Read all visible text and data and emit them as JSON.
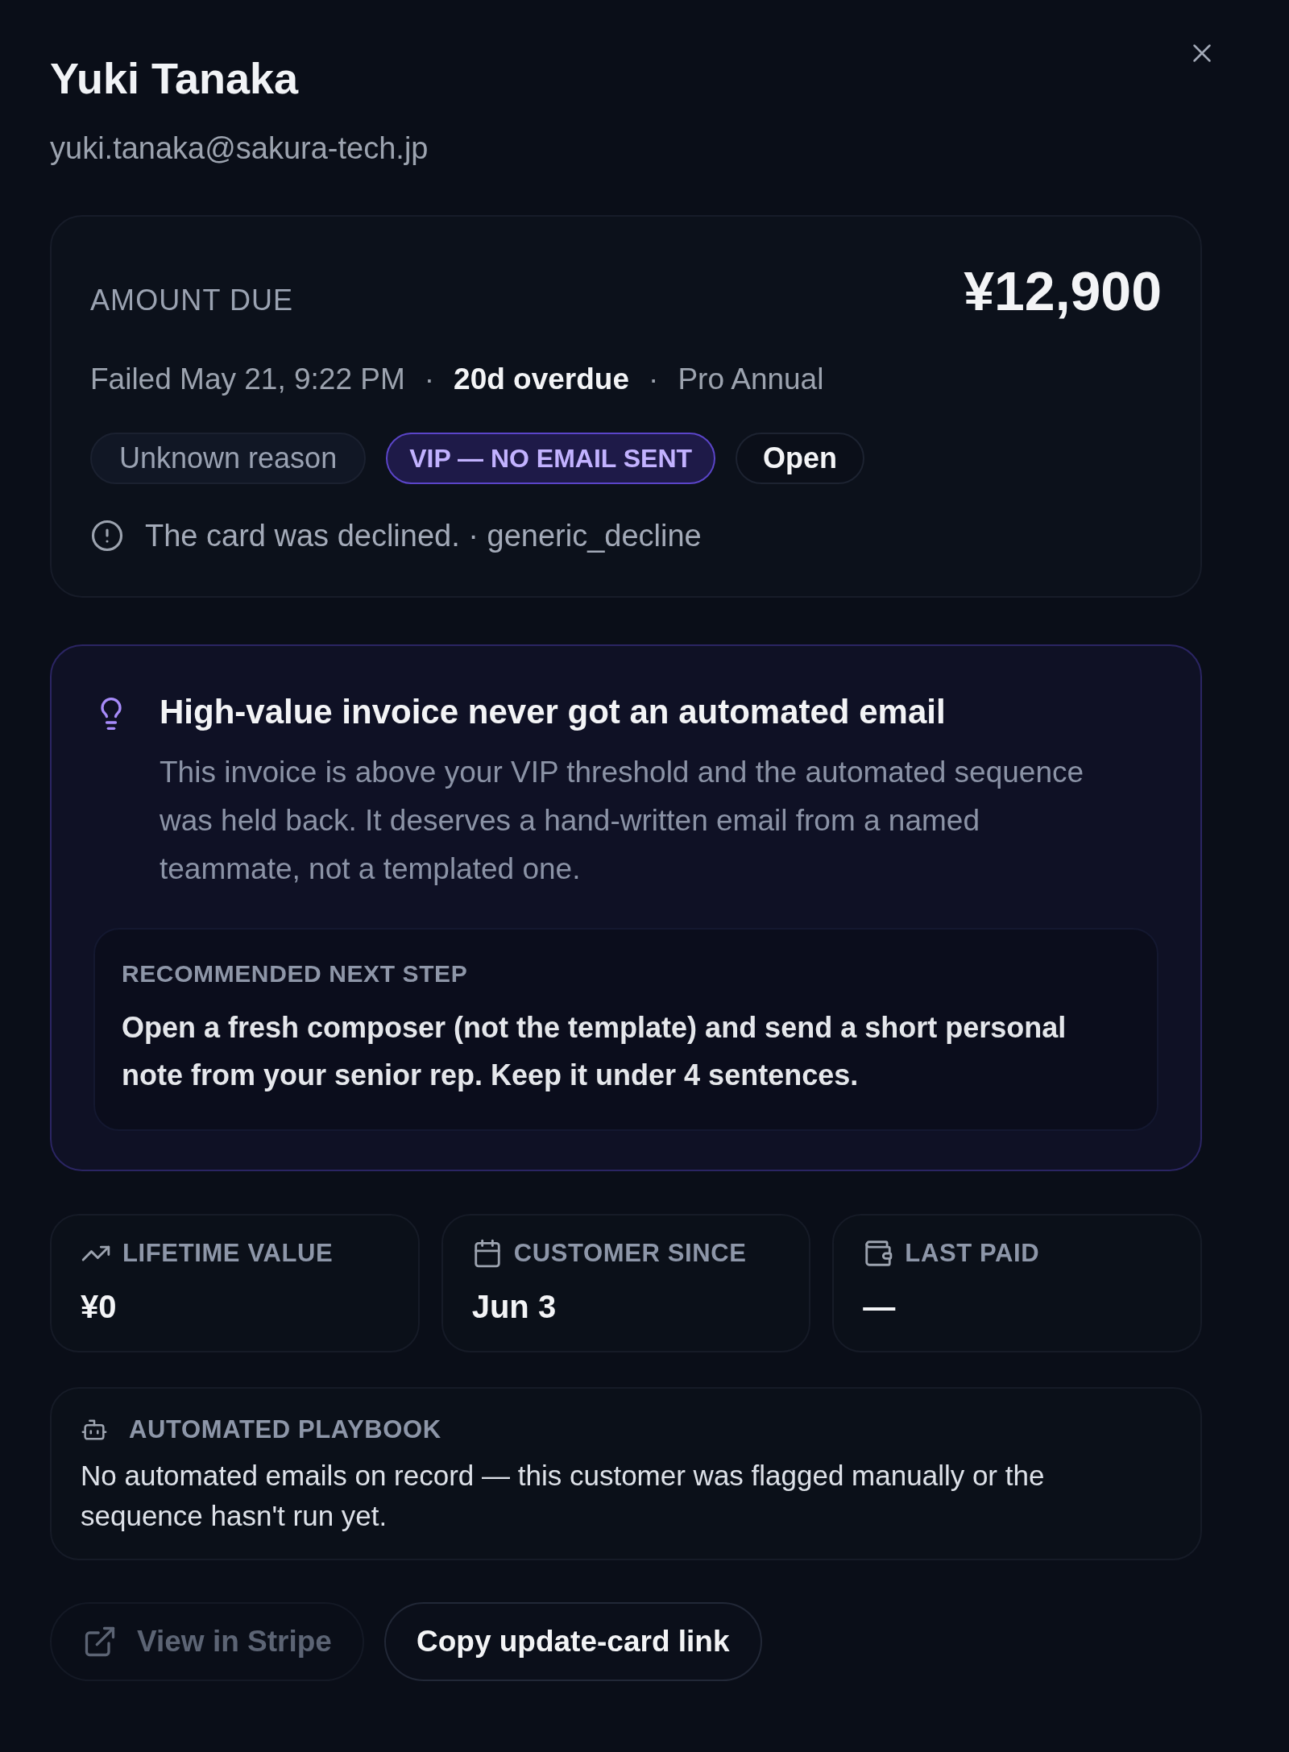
{
  "header": {
    "name": "Yuki Tanaka",
    "email": "yuki.tanaka@sakura-tech.jp"
  },
  "amount_card": {
    "label": "AMOUNT DUE",
    "amount": "¥12,900",
    "meta": [
      {
        "text": "Failed May 21, 9:22 PM",
        "emphasis": false
      },
      {
        "separator": "·",
        "text": "20d overdue",
        "emphasis": true
      },
      {
        "separator": "·",
        "text": "Pro Annual",
        "emphasis": false
      }
    ],
    "tags": [
      {
        "label": "Unknown reason",
        "kind": "reason"
      },
      {
        "label": "VIP — NO EMAIL SENT",
        "kind": "vip"
      },
      {
        "label": "Open",
        "kind": "status"
      }
    ],
    "decline_note": "The card was declined. · generic_decline"
  },
  "insight": {
    "title": "High-value invoice never got an automated email",
    "body": "This invoice is above your VIP threshold and the automated sequence was held back. It deserves a hand-written email from a named teammate, not a templated one.",
    "recommendation": {
      "label": "RECOMMENDED NEXT STEP",
      "text": "Open a fresh composer (not the template) and send a short personal note from your senior rep. Keep it under 4 sentences."
    }
  },
  "stats": [
    {
      "label": "LIFETIME VALUE",
      "value": "¥0"
    },
    {
      "label": "CUSTOMER SINCE",
      "value": "Jun 3"
    },
    {
      "label": "LAST PAID",
      "value": "—"
    }
  ],
  "playbook": {
    "label": "AUTOMATED PLAYBOOK",
    "text": "No automated emails on record — this customer was flagged manually or the sequence hasn't run yet."
  },
  "actions": [
    {
      "label": "View in Stripe",
      "kind": "external",
      "disabled": true
    },
    {
      "label": "Copy update-card link",
      "kind": "plain",
      "disabled": false
    }
  ]
}
